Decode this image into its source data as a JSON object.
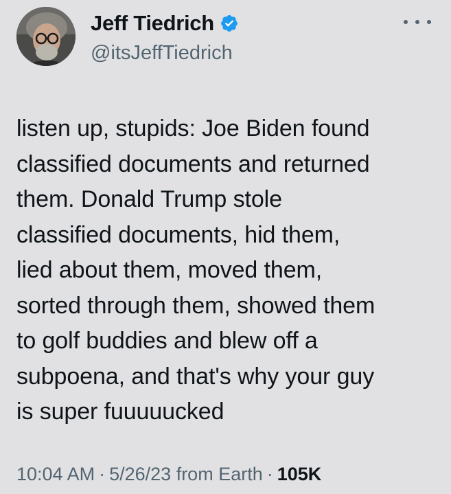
{
  "author": {
    "display_name": "Jeff Tiedrich",
    "handle": "@itsJeffTiedrich",
    "verified": true,
    "verified_color": "#1d9bf0",
    "avatar_icon": "profile-photo"
  },
  "menu": {
    "more_icon": "more-horizontal-icon"
  },
  "tweet": {
    "text": "listen up, stupids: Joe Biden found\nclassified documents and returned\nthem. Donald Trump stole\nclassified documents, hid them,\nlied about them, moved them,\nsorted through them, showed them\nto golf buddies and blew off a\nsubpoena, and that's why your guy\nis super fuuuuucked"
  },
  "meta": {
    "time": "10:04 AM",
    "separator": "·",
    "date": "5/26/23",
    "source": "from Earth",
    "views": "105K"
  },
  "colors": {
    "background": "#e1e1e3",
    "text_primary": "#0f1419",
    "text_secondary": "#536471"
  }
}
